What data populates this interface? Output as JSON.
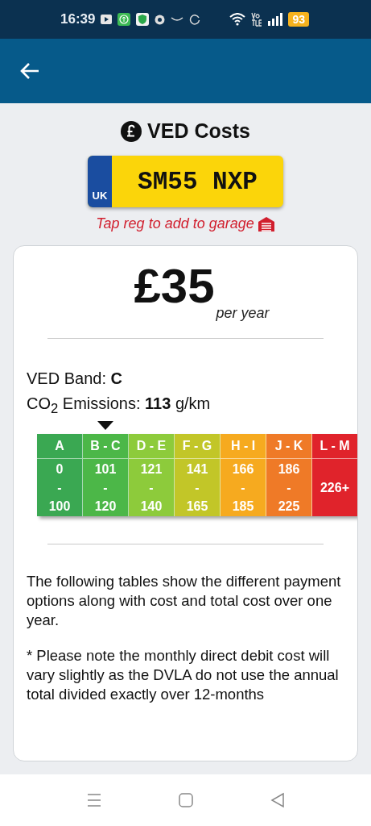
{
  "status_bar": {
    "time": "16:39",
    "battery": "93"
  },
  "title": "VED Costs",
  "plate": {
    "country": "UK",
    "registration": "SM55 NXP"
  },
  "garage_hint": "Tap reg to add to garage",
  "price": {
    "amount": "£35",
    "period": "per year"
  },
  "band_line": "VED Band: **C**",
  "emissions_line": "CO$_{2}$ Emissions: **113** g/km",
  "bands": [
    {
      "label": "A",
      "lines": [
        "0",
        "-",
        "100"
      ],
      "color": "#3aa852",
      "selected": false
    },
    {
      "label": "B - C",
      "lines": [
        "101",
        "-",
        "120"
      ],
      "color": "#4cb748",
      "selected": true
    },
    {
      "label": "D - E",
      "lines": [
        "121",
        "-",
        "140"
      ],
      "color": "#8dcb3b",
      "selected": false
    },
    {
      "label": "F - G",
      "lines": [
        "141",
        "-",
        "165"
      ],
      "color": "#c2c628",
      "selected": false
    },
    {
      "label": "H - I",
      "lines": [
        "166",
        "-",
        "185"
      ],
      "color": "#f6aa1f",
      "selected": false
    },
    {
      "label": "J - K",
      "lines": [
        "186",
        "-",
        "225"
      ],
      "color": "#ef7a27",
      "selected": false
    },
    {
      "label": "L - M",
      "lines": [
        "226+"
      ],
      "color": "#e0232b",
      "selected": false
    }
  ],
  "paragraphs": [
    "The following tables show the different payment options along with cost and total cost over one year.",
    "* Please note the monthly direct debit cost will vary slightly as the DVLA do not use the annual total divided exactly over 12-months"
  ]
}
